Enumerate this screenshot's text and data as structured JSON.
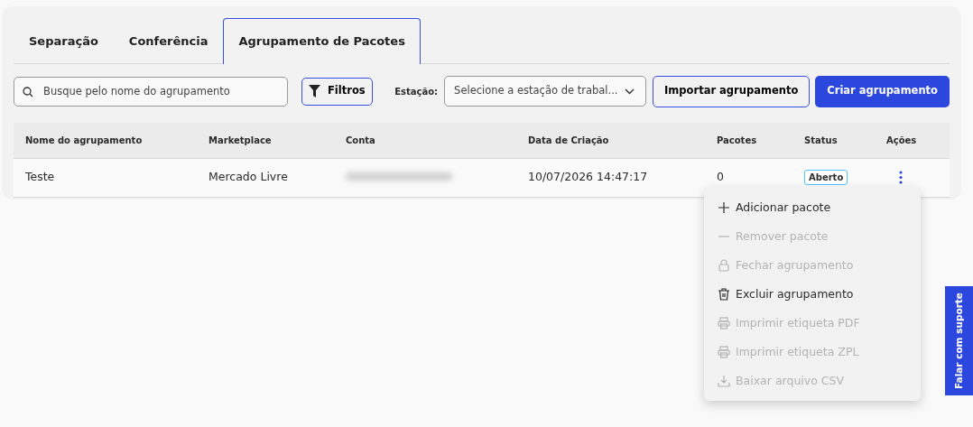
{
  "tabs": [
    {
      "label": "Separação",
      "selected": false
    },
    {
      "label": "Conferência",
      "selected": false
    },
    {
      "label": "Agrupamento de Pacotes",
      "selected": true
    }
  ],
  "toolbar": {
    "search": {
      "placeholder": "Busque pelo nome do agrupamento"
    },
    "filter_button": "Filtros",
    "station_label": "Estação:",
    "station_select": {
      "placeholder": "Selecione a estação de trabal..."
    },
    "import_button": "Importar agrupamento",
    "create_button": "Criar agrupamento"
  },
  "table": {
    "columns": [
      "Nome do agrupamento",
      "Marketplace",
      "Conta",
      "Data de Criação",
      "Pacotes",
      "Status",
      "Ações"
    ],
    "rows": [
      {
        "name": "Teste",
        "marketplace": "Mercado Livre",
        "account_redacted": true,
        "created": "10/07/2026 14:47:17",
        "packages": "0",
        "status": "Aberto"
      }
    ]
  },
  "actions_menu": [
    {
      "label": "Adicionar pacote",
      "kind": "add",
      "disabled": false
    },
    {
      "label": "Remover pacote",
      "kind": "remove",
      "disabled": true
    },
    {
      "label": "Fechar agrupamento",
      "kind": "lock",
      "disabled": true
    },
    {
      "label": "Excluir agrupamento",
      "kind": "delete",
      "disabled": false
    },
    {
      "label": "Imprimir etiqueta PDF",
      "kind": "print",
      "disabled": true
    },
    {
      "label": "Imprimir etiqueta ZPL",
      "kind": "print",
      "disabled": true
    },
    {
      "label": "Baixar arquivo CSV",
      "kind": "download",
      "disabled": true
    }
  ],
  "support_button": "Falar com suporte"
}
